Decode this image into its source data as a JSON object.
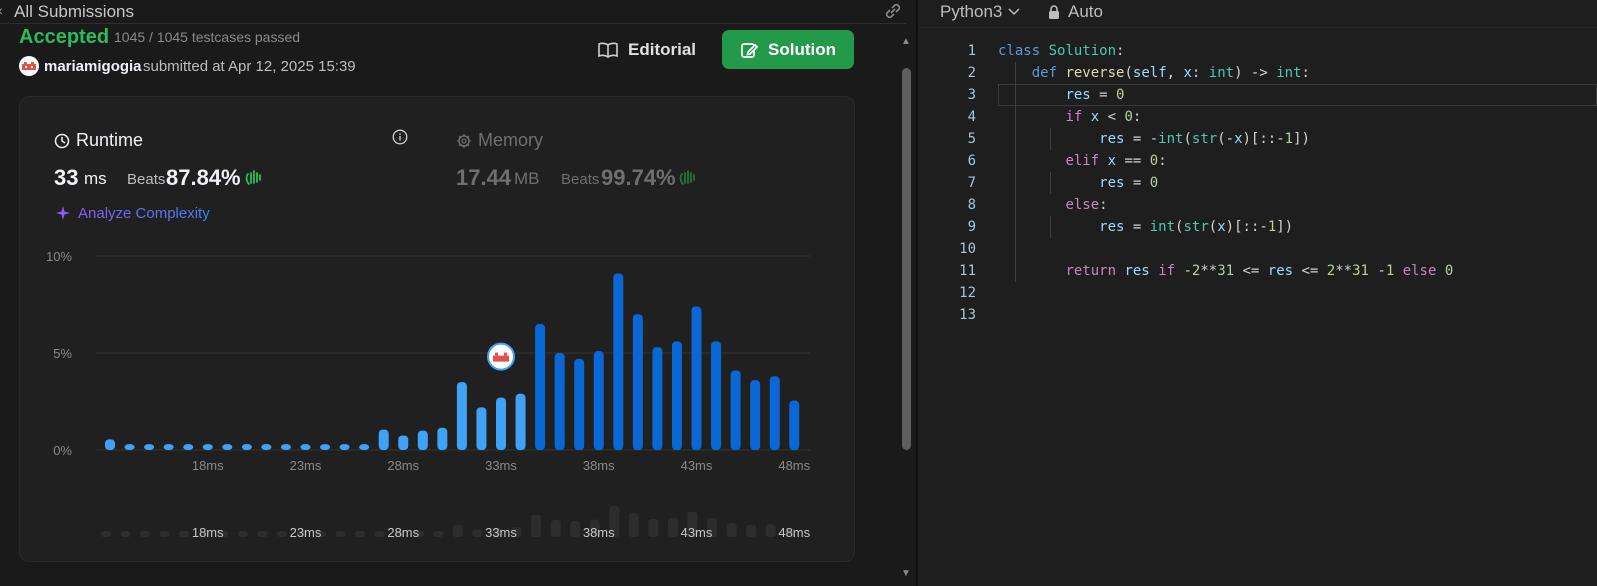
{
  "header": {
    "back_label": "All Submissions",
    "link_icon": "link-icon"
  },
  "submission": {
    "status": "Accepted",
    "testcases": "1045 / 1045 testcases passed",
    "username": "mariamigogia",
    "submitted_at": "submitted at Apr 12, 2025 15:39"
  },
  "buttons": {
    "editorial": "Editorial",
    "solution": "Solution"
  },
  "runtime": {
    "label": "Runtime",
    "value": "33",
    "unit": "ms",
    "beats_label": "Beats",
    "beats_pct": "87.84%"
  },
  "memory": {
    "label": "Memory",
    "value": "17.44",
    "unit": "MB",
    "beats_label": "Beats",
    "beats_pct": "99.74%"
  },
  "analyze_label": "Analyze Complexity",
  "colors": {
    "accepted": "#2cbb5d",
    "solution_btn": "#239a4a",
    "bar_light": "#3fa2f7",
    "bar_dark": "#0a67d6",
    "bar_mini": "#2d2d2d",
    "emoji_green": "#2cbb5d"
  },
  "chart_data": {
    "type": "bar",
    "ylabel_ticks": [
      "10%",
      "5%",
      "0%"
    ],
    "ylim": [
      0,
      10
    ],
    "x_tick_labels": [
      "18ms",
      "23ms",
      "28ms",
      "33ms",
      "38ms",
      "43ms",
      "48ms"
    ],
    "series": [
      {
        "values": [
          0.55,
          0.3,
          0.3,
          0.3,
          0.3,
          0.3,
          0.3,
          0.3,
          0.3,
          0.3,
          0.3,
          0.3,
          0.3,
          0.3,
          1.05,
          0.75,
          1.0,
          1.15,
          3.5,
          2.2,
          2.7,
          2.9,
          6.5,
          5.0,
          4.7,
          5.1,
          9.1,
          7.0,
          5.3,
          5.6,
          7.4,
          5.6,
          4.1,
          3.6,
          3.8,
          2.55
        ],
        "highlighted_index_range": [
          0,
          21
        ]
      }
    ],
    "marker_at_index": 20,
    "mini_x_tick_labels": [
      "18ms",
      "23ms",
      "28ms",
      "33ms",
      "38ms",
      "43ms",
      "48ms"
    ]
  },
  "editor": {
    "language": "Python3",
    "mode": "Auto",
    "line_numbers": [
      "1",
      "2",
      "3",
      "4",
      "5",
      "6",
      "7",
      "8",
      "9",
      "10",
      "11",
      "12",
      "13"
    ]
  }
}
